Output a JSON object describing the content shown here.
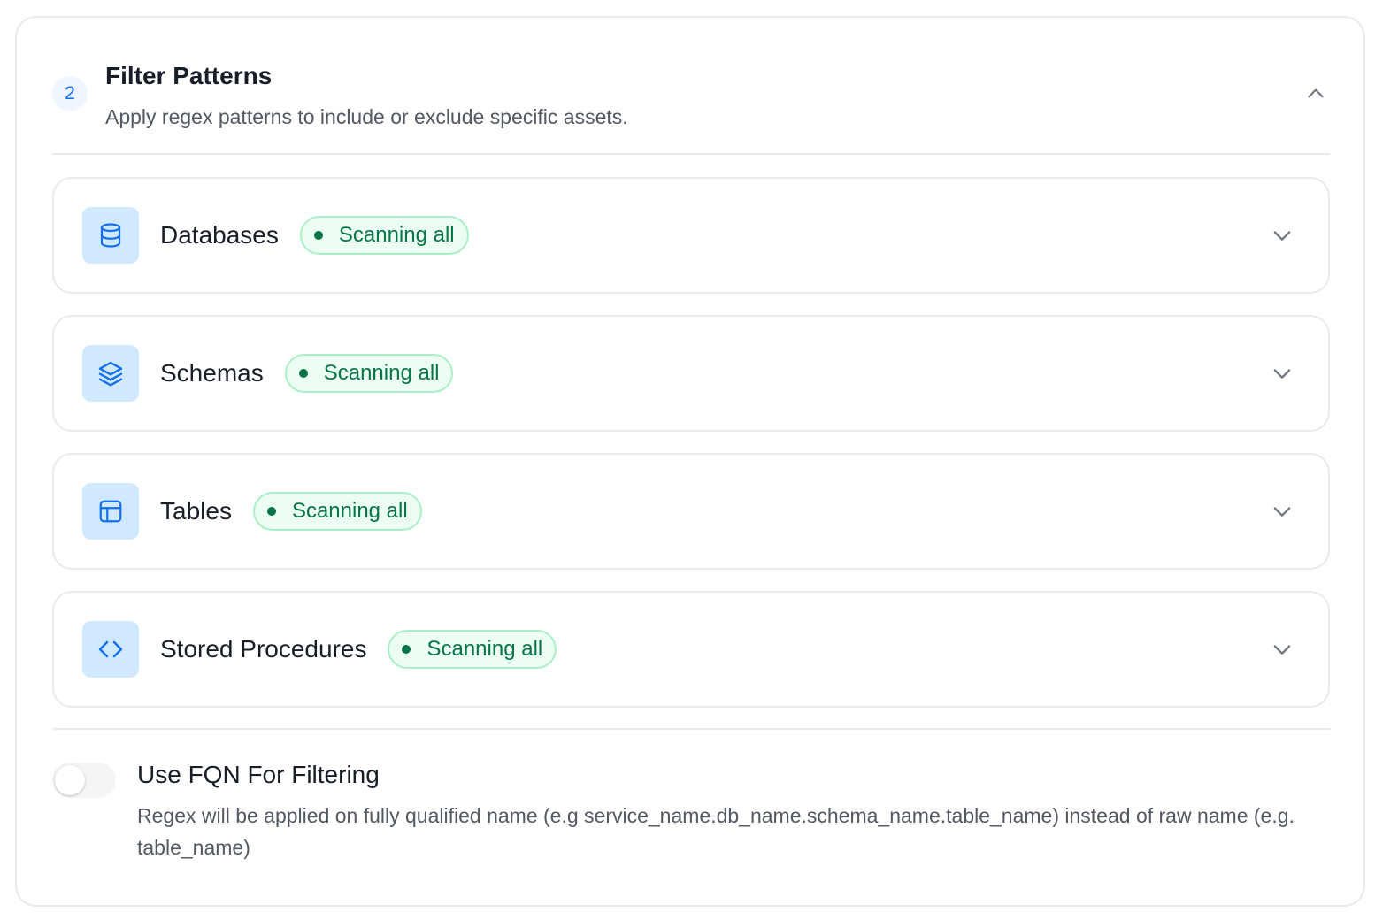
{
  "section": {
    "step_number": "2",
    "title": "Filter Patterns",
    "subtitle": "Apply regex patterns to include or exclude specific assets."
  },
  "filters": [
    {
      "label": "Databases",
      "icon": "database-icon",
      "status": "Scanning all"
    },
    {
      "label": "Schemas",
      "icon": "layers-icon",
      "status": "Scanning all"
    },
    {
      "label": "Tables",
      "icon": "table-icon",
      "status": "Scanning all"
    },
    {
      "label": "Stored Procedures",
      "icon": "code-icon",
      "status": "Scanning all"
    }
  ],
  "fqn": {
    "title": "Use FQN For Filtering",
    "description": "Regex will be applied on fully qualified name (e.g service_name.db_name.schema_name.table_name) instead of raw name (e.g. table_name)",
    "enabled": false
  },
  "colors": {
    "accent": "#1570ef",
    "icon_bg": "#d1e9ff",
    "status_text": "#067647",
    "status_bg": "#ecfdf3",
    "status_border": "#abefc6"
  }
}
